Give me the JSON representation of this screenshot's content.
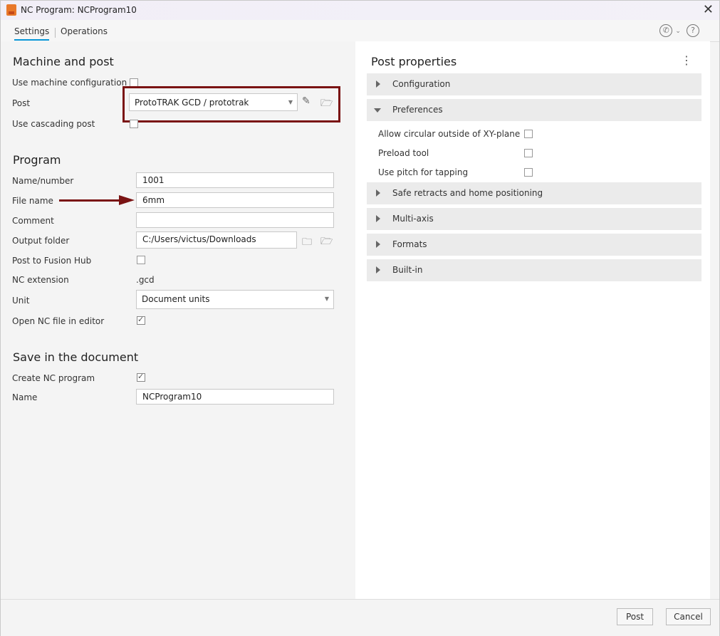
{
  "window": {
    "title": "NC Program: NCProgram10"
  },
  "tabs": [
    {
      "label": "Settings"
    },
    {
      "label": "Operations"
    }
  ],
  "machine_and_post": {
    "heading": "Machine and post",
    "use_machine_configuration": {
      "label": "Use machine configuration",
      "checked": false
    },
    "post": {
      "label": "Post",
      "value": "ProtoTRAK GCD / prototrak"
    },
    "use_cascading_post": {
      "label": "Use cascading post",
      "checked": false
    }
  },
  "program": {
    "heading": "Program",
    "name_number": {
      "label": "Name/number",
      "value": "1001"
    },
    "file_name": {
      "label": "File name",
      "value": "6mm"
    },
    "comment": {
      "label": "Comment",
      "value": ""
    },
    "output_folder": {
      "label": "Output folder",
      "value": "C:/Users/victus/Downloads"
    },
    "post_to_fusion_hub": {
      "label": "Post to Fusion Hub",
      "checked": false
    },
    "nc_extension": {
      "label": "NC extension",
      "value": ".gcd"
    },
    "unit": {
      "label": "Unit",
      "value": "Document units"
    },
    "open_nc_file": {
      "label": "Open NC file in editor",
      "checked": true
    }
  },
  "save_in_document": {
    "heading": "Save in the document",
    "create_nc_program": {
      "label": "Create NC program",
      "checked": true
    },
    "name": {
      "label": "Name",
      "value": "NCProgram10"
    }
  },
  "post_properties": {
    "title": "Post properties",
    "groups": [
      {
        "label": "Configuration",
        "expanded": false
      },
      {
        "label": "Preferences",
        "expanded": true
      },
      {
        "label": "Safe retracts and home positioning",
        "expanded": false
      },
      {
        "label": "Multi-axis",
        "expanded": false
      },
      {
        "label": "Formats",
        "expanded": false
      },
      {
        "label": "Built-in",
        "expanded": false
      }
    ],
    "preferences": [
      {
        "label": "Allow circular outside of XY-plane",
        "checked": false
      },
      {
        "label": "Preload tool",
        "checked": false
      },
      {
        "label": "Use pitch for tapping",
        "checked": false
      }
    ]
  },
  "footer": {
    "post_label": "Post",
    "cancel_label": "Cancel"
  },
  "colors": {
    "accent": "#0696d7",
    "highlight": "#7a1313"
  }
}
